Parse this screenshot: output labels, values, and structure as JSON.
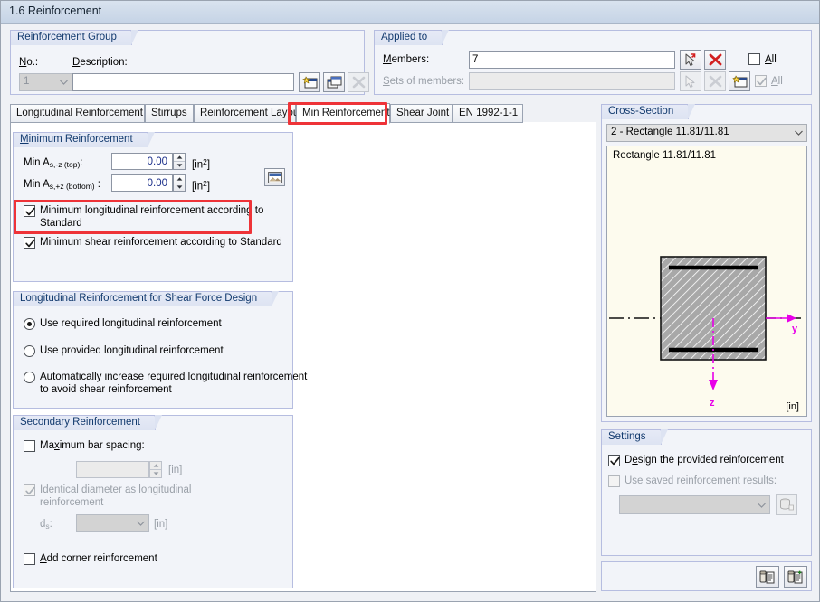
{
  "window": {
    "title": "1.6 Reinforcement"
  },
  "reinforcement_group": {
    "caption": "Reinforcement Group",
    "no_label": "No.:",
    "no_value": "1",
    "description_label": "Description:",
    "description_value": "",
    "buttons": [
      {
        "name": "new-reinforcement-group-button",
        "title": "New"
      },
      {
        "name": "copy-reinforcement-group-button",
        "title": "Copy"
      },
      {
        "name": "delete-reinforcement-group-button",
        "title": "Delete"
      }
    ]
  },
  "applied_to": {
    "caption": "Applied to",
    "members_label": "Members:",
    "members_value": "7",
    "sets_label": "Sets of members:",
    "sets_value": "",
    "all_label_1": "All",
    "all_label_2": "All",
    "all_checked_1": false,
    "all_checked_2": true,
    "buttons": [
      {
        "name": "pick-members-button"
      },
      {
        "name": "clear-members-button"
      },
      {
        "name": "pick-sets-button"
      },
      {
        "name": "clear-sets-button"
      },
      {
        "name": "new-set-of-members-button"
      }
    ]
  },
  "tabs": [
    {
      "label": "Longitudinal Reinforcement",
      "selected": false
    },
    {
      "label": "Stirrups",
      "selected": false
    },
    {
      "label": "Reinforcement Layout",
      "selected": false
    },
    {
      "label": "Min Reinforcement",
      "selected": true
    },
    {
      "label": "Shear Joint",
      "selected": false
    },
    {
      "label": "EN 1992-1-1",
      "selected": false
    }
  ],
  "minimum_reinforcement": {
    "caption": "Minimum Reinforcement",
    "rows": [
      {
        "prefix": "Min A",
        "sub": "s,-z (top)",
        "suffix": ":",
        "value": "0.00",
        "unit_pre": "[in",
        "unit_sup": "2",
        "unit_post": "]"
      },
      {
        "prefix": "Min A",
        "sub": "s,+z (bottom)",
        "suffix": " :",
        "value": "0.00",
        "unit_pre": "[in",
        "unit_sup": "2",
        "unit_post": "]"
      }
    ],
    "picture_button": "section-picture-button",
    "check_longitudinal": {
      "label_line1": "Minimum longitudinal reinforcement according to",
      "label_line2": "Standard",
      "checked": true
    },
    "check_shear": {
      "label": "Minimum shear reinforcement according to Standard",
      "checked": true
    }
  },
  "longitudinal_shear": {
    "caption": "Longitudinal Reinforcement for Shear Force Design",
    "options": [
      {
        "label_line1": "Use required longitudinal reinforcement",
        "label_line2": "",
        "selected": true
      },
      {
        "label_line1": "Use provided longitudinal reinforcement",
        "label_line2": "",
        "selected": false
      },
      {
        "label_line1": "Automatically increase required longitudinal reinforcement",
        "label_line2": "to avoid shear reinforcement",
        "selected": false
      }
    ]
  },
  "secondary_reinforcement": {
    "caption": "Secondary Reinforcement",
    "max_bar_spacing": {
      "label": "Maximum bar spacing:",
      "checked": false,
      "value": "",
      "unit": "[in]"
    },
    "identical_diameter": {
      "label_line1": "Identical diameter as longitudinal",
      "label_line2": "reinforcement",
      "checked": true,
      "disabled": true
    },
    "ds": {
      "label_pre": "d",
      "label_sub": "s",
      "label_post": ":",
      "value": "",
      "unit": "[in]"
    },
    "add_corner": {
      "label": "Add corner reinforcement",
      "checked": false
    }
  },
  "cross_section": {
    "caption": "Cross-Section",
    "selected": "2 - Rectangle 11.81/11.81",
    "drawing_title": "Rectangle 11.81/11.81",
    "unit": "[in]",
    "axis_y_label": "y",
    "axis_z_label": "z",
    "axis_color": "#e800e8"
  },
  "settings": {
    "caption": "Settings",
    "design_provided": {
      "label": "Design the provided reinforcement",
      "checked": true
    },
    "use_saved": {
      "label": "Use saved reinforcement results:",
      "checked": false,
      "disabled": true
    },
    "saved_combo_value": "",
    "saved_button": "saved-results-button"
  },
  "bottom_toolbar": {
    "buttons": [
      {
        "name": "copy-settings-button"
      },
      {
        "name": "paste-settings-button"
      }
    ]
  },
  "colors": {
    "accent_caption": "#123a6e",
    "annotation": "#ee3338",
    "value_text": "#1b2f8a",
    "cross_section_bg": "#fdfbee"
  }
}
